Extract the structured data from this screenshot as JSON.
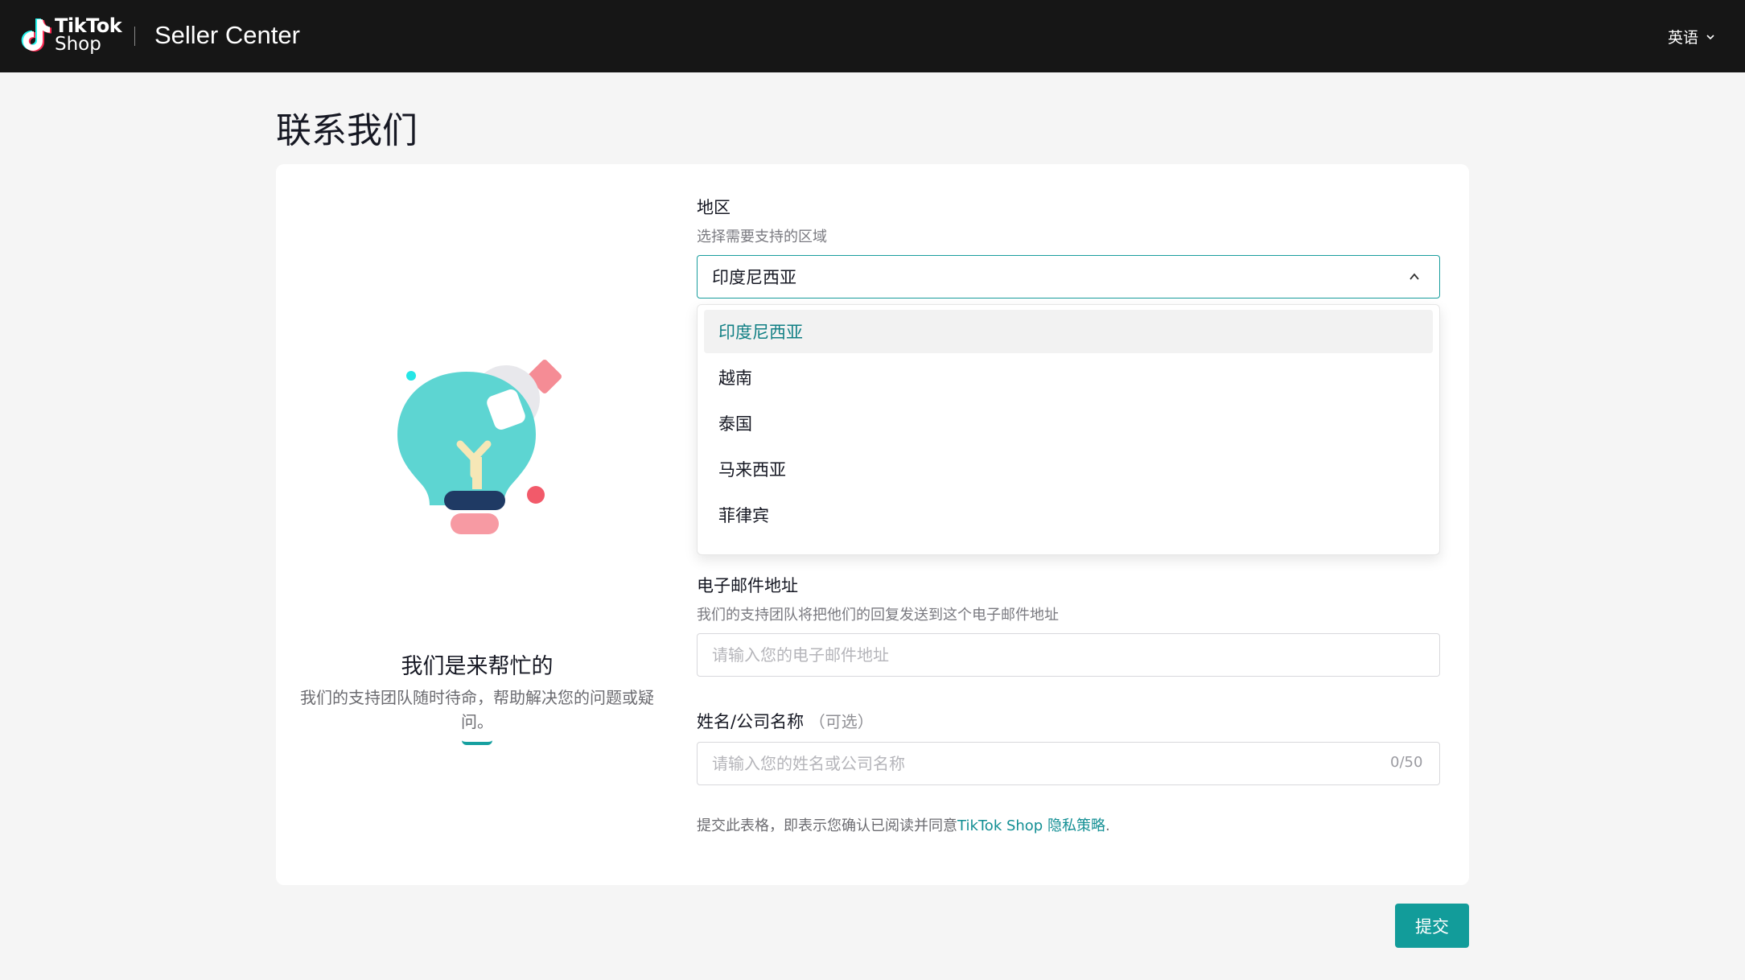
{
  "header": {
    "brand_line1": "TikTok",
    "brand_line2": "Shop",
    "title": "Seller Center",
    "language": "英语"
  },
  "page": {
    "title": "联系我们"
  },
  "illustration": {
    "heading": "我们是来帮忙的",
    "description": "我们的支持团队随时待命，帮助解决您的问题或疑问。"
  },
  "form": {
    "region": {
      "label": "地区",
      "hint": "选择需要支持的区域",
      "value": "印度尼西亚",
      "options": [
        "印度尼西亚",
        "越南",
        "泰国",
        "马来西亚",
        "菲律宾"
      ]
    },
    "email": {
      "label": "电子邮件地址",
      "hint": "我们的支持团队将把他们的回复发送到这个电子邮件地址",
      "placeholder": "请输入您的电子邮件地址"
    },
    "name": {
      "label": "姓名/公司名称",
      "optional": "（可选）",
      "placeholder": "请输入您的姓名或公司名称",
      "counter": "0/50"
    },
    "consent_prefix": "提交此表格，即表示您确认已阅读并同意",
    "consent_link": "TikTok Shop 隐私策略",
    "consent_suffix": "."
  },
  "actions": {
    "submit_label": "提交"
  },
  "colors": {
    "accent": "#129c9a",
    "header_bg": "#161616",
    "page_bg": "#f5f5f5"
  }
}
